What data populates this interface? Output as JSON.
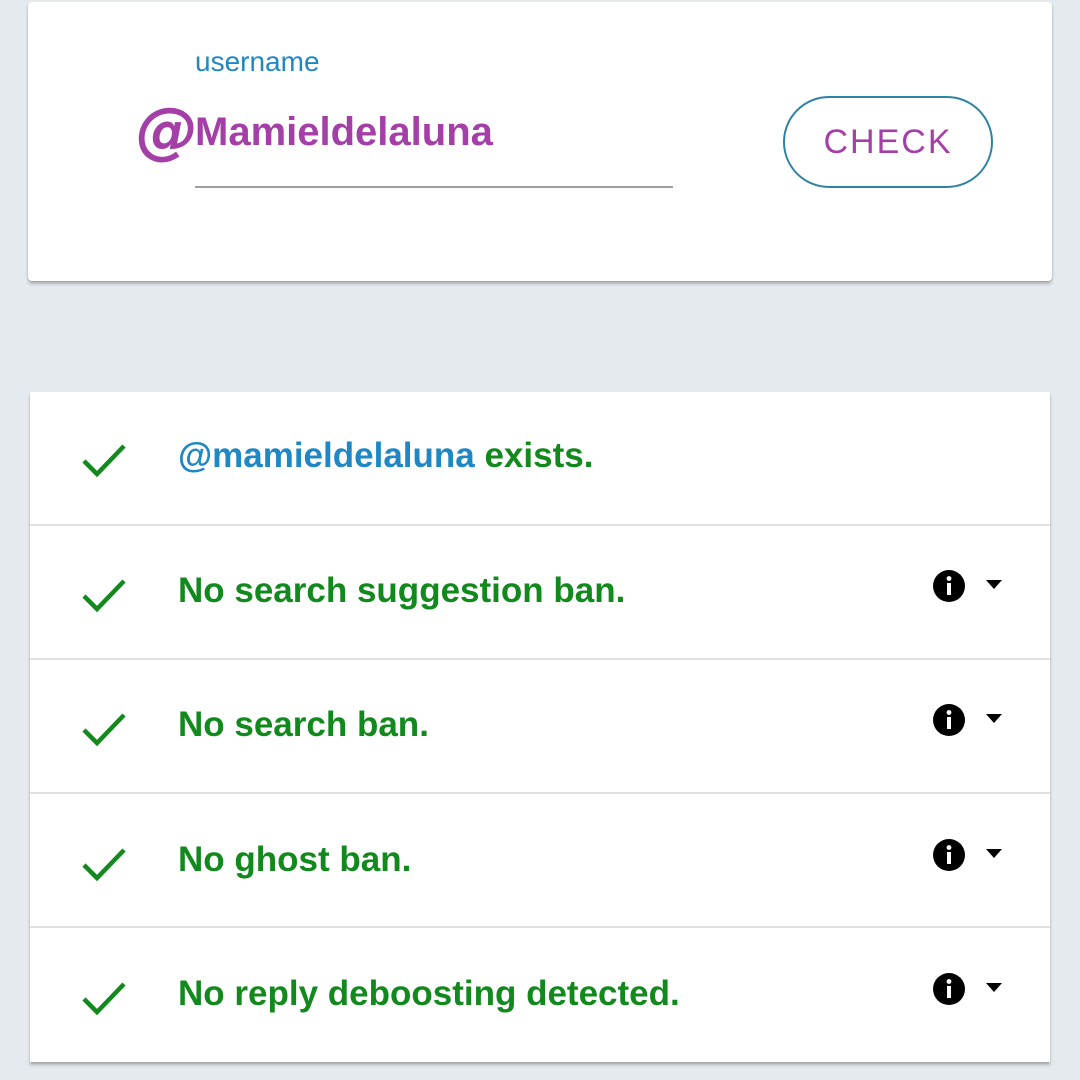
{
  "search": {
    "at_symbol": "@",
    "label": "username",
    "value": "Mamieldelaluna",
    "button_label": "CHECK"
  },
  "results": {
    "exists": {
      "handle": "@mamieldelaluna",
      "suffix": " exists.",
      "status": "pass",
      "icon": "check-icon"
    },
    "items": [
      {
        "label": "No search suggestion ban.",
        "status": "pass",
        "icon": "check-icon",
        "info_icon": "info-icon",
        "toggle_icon": "caret-down-icon"
      },
      {
        "label": "No search ban.",
        "status": "pass",
        "icon": "check-icon",
        "info_icon": "info-icon",
        "toggle_icon": "caret-down-icon"
      },
      {
        "label": "No ghost ban.",
        "status": "pass",
        "icon": "check-icon",
        "info_icon": "info-icon",
        "toggle_icon": "caret-down-icon"
      },
      {
        "label": "No reply deboosting detected.",
        "status": "pass",
        "icon": "check-icon",
        "info_icon": "info-icon",
        "toggle_icon": "caret-down-icon"
      }
    ]
  },
  "colors": {
    "accent_purple": "#a53fa8",
    "accent_blue": "#1f88c4",
    "success_green": "#12891c",
    "background": "#e5eaee"
  }
}
